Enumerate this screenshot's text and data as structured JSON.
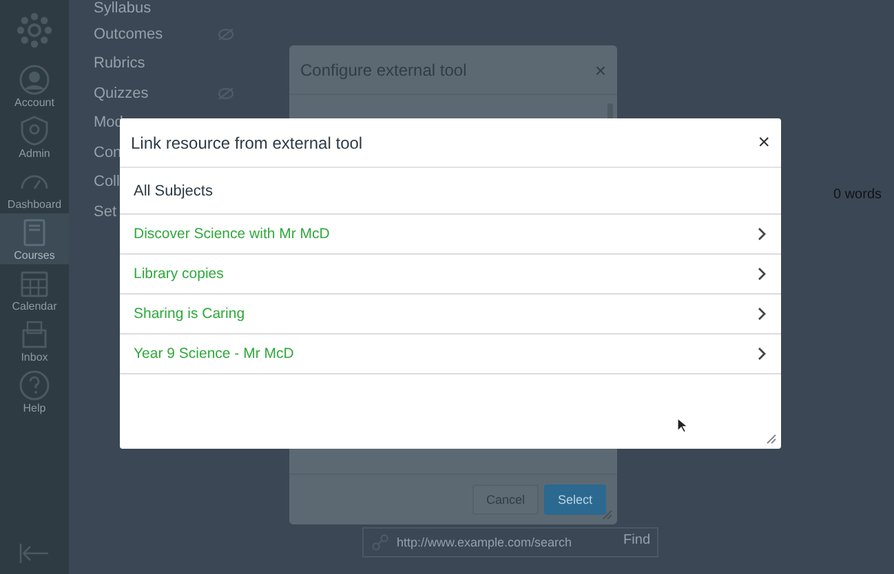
{
  "global_nav": [
    {
      "label": "Account",
      "selected": false
    },
    {
      "label": "Admin",
      "selected": false
    },
    {
      "label": "Dashboard",
      "selected": false
    },
    {
      "label": "Courses",
      "selected": true
    },
    {
      "label": "Calendar",
      "selected": false
    },
    {
      "label": "Inbox",
      "selected": false
    },
    {
      "label": "Help",
      "selected": false
    }
  ],
  "course_nav": [
    {
      "label": "Syllabus"
    },
    {
      "label": "Outcomes",
      "hidden_icon": true
    },
    {
      "label": "Rubrics"
    },
    {
      "label": "Quizzes",
      "hidden_icon": true
    },
    {
      "label": "Mod"
    },
    {
      "label": "Con"
    },
    {
      "label": "Coll"
    },
    {
      "label": "Set"
    }
  ],
  "word_count": "0 words",
  "link_field": {
    "placeholder": "http://www.example.com/search",
    "button": "Find"
  },
  "config_dialog": {
    "title": "Configure external tool",
    "close": "×",
    "buttons": [
      {
        "label": "Cancel",
        "kind": "secondary"
      },
      {
        "label": "Select",
        "kind": "primary"
      }
    ]
  },
  "modal": {
    "title": "Link resource from external tool",
    "close": "×",
    "items": [
      {
        "label": "All Subjects",
        "kind": "heading"
      },
      {
        "label": "Discover Science with Mr McD",
        "kind": "link"
      },
      {
        "label": "Library copies",
        "kind": "link"
      },
      {
        "label": "Sharing is Caring",
        "kind": "link"
      },
      {
        "label": "Year 9 Science - Mr McD",
        "kind": "link"
      }
    ]
  }
}
